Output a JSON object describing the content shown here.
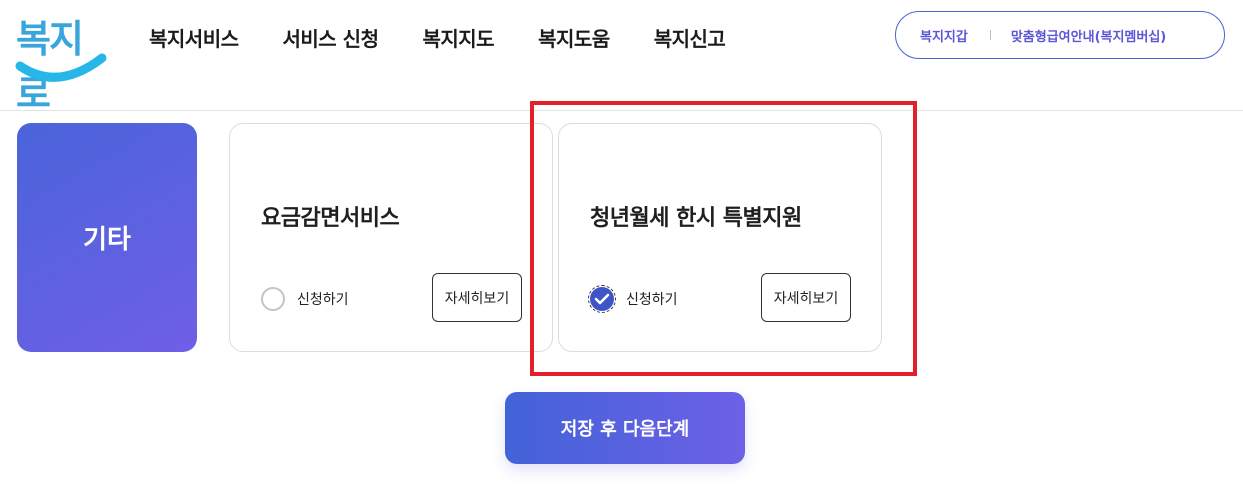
{
  "header": {
    "logo_text": "복지로",
    "nav": [
      "복지서비스",
      "서비스 신청",
      "복지지도",
      "복지도움",
      "복지신고"
    ],
    "util_links": [
      "복지지갑",
      "맞춤형급여안내(복지멤버십)"
    ]
  },
  "category": {
    "label": "기타"
  },
  "cards": [
    {
      "title": "요금감면서비스",
      "apply_label": "신청하기",
      "detail_label": "자세히보기",
      "checked": false
    },
    {
      "title": "청년월세 한시 특별지원",
      "apply_label": "신청하기",
      "detail_label": "자세히보기",
      "checked": true
    }
  ],
  "save_button": {
    "label": "저장 후 다음단계"
  },
  "colors": {
    "accent": "#4a63cf",
    "highlight": "#e3202a",
    "logo": "#3aa5dc",
    "check": "#3d55c9"
  }
}
